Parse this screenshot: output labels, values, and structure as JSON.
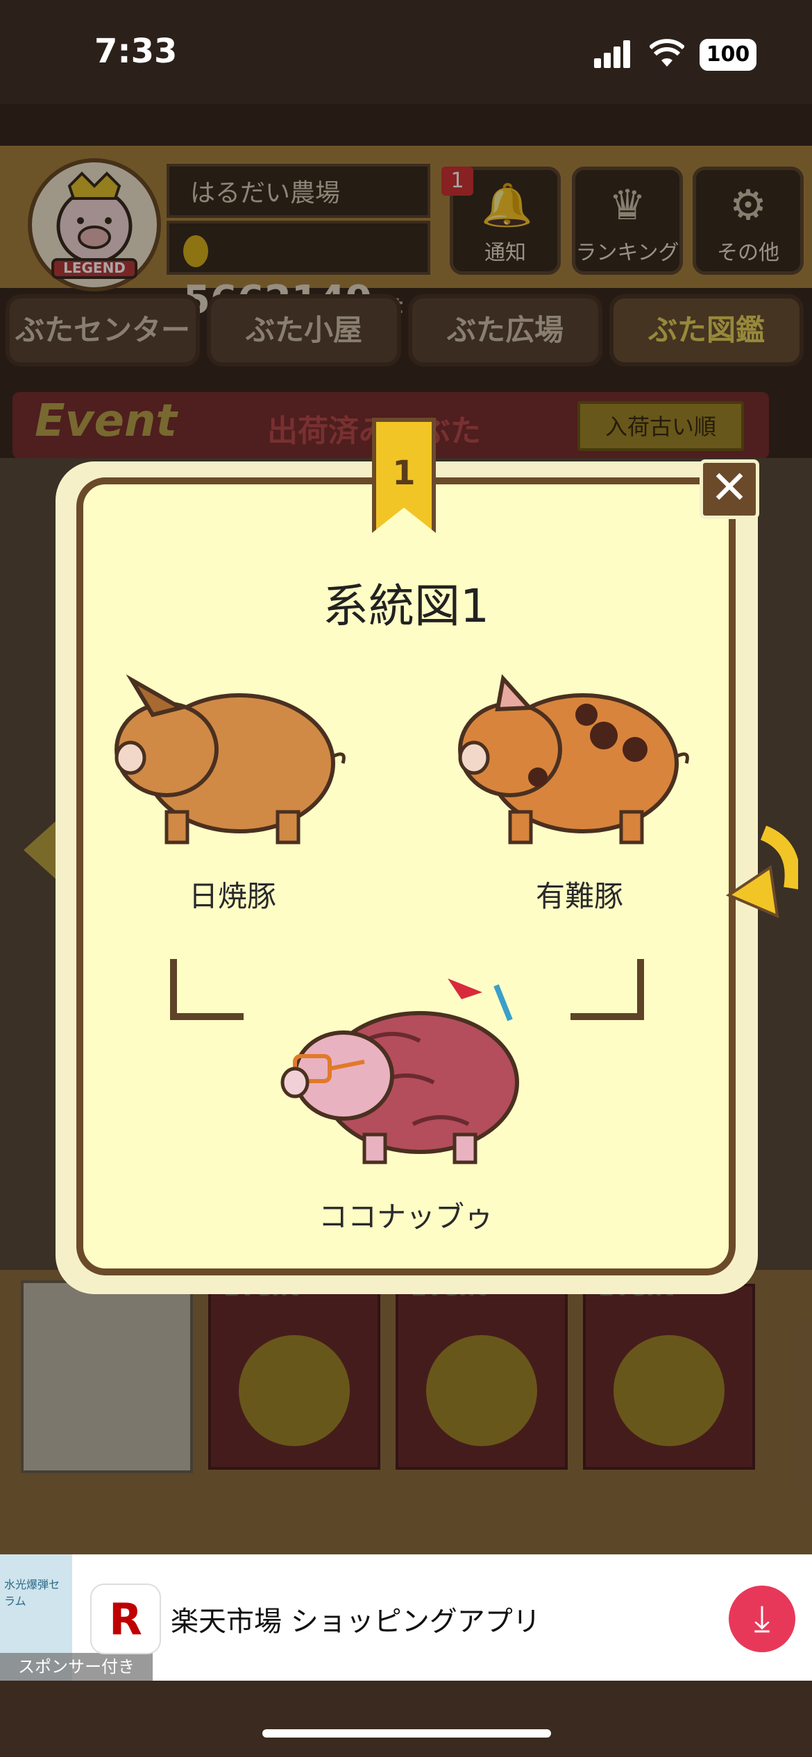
{
  "status_bar": {
    "time": "7:33",
    "battery": "100"
  },
  "header": {
    "badge_text": "LEGEND",
    "farm_name": "はるだい農場",
    "points": "5662149",
    "points_unit": "pt",
    "buttons": [
      {
        "label": "通知",
        "icon": "bell-icon",
        "count": "1"
      },
      {
        "label": "ランキング",
        "icon": "crown-icon"
      },
      {
        "label": "その他",
        "icon": "gear-icon"
      }
    ]
  },
  "tabs": [
    "ぶたセンター",
    "ぶた小屋",
    "ぶた広場",
    "ぶた図鑑"
  ],
  "event_bar": {
    "logo": "Event",
    "title": "出荷済みのぶた",
    "sort_label": "入荷古い順"
  },
  "event_cards": [
    "Event",
    "Event",
    "Event"
  ],
  "modal": {
    "ribbon_number": "1",
    "title": "系統図1",
    "parents": [
      {
        "name": "日焼豚",
        "color": "#d08a45"
      },
      {
        "name": "有難豚",
        "color": "#d9843c"
      }
    ],
    "child": {
      "name": "ココナッブゥ",
      "color": "#b44d5c"
    }
  },
  "ad": {
    "app_name": "楽天市場 ショッピングアプリ",
    "icon_letter": "R",
    "sponsor_label": "スポンサー付き",
    "thumb_text": "水光爆弾セラム",
    "accent": "#e8385a"
  }
}
